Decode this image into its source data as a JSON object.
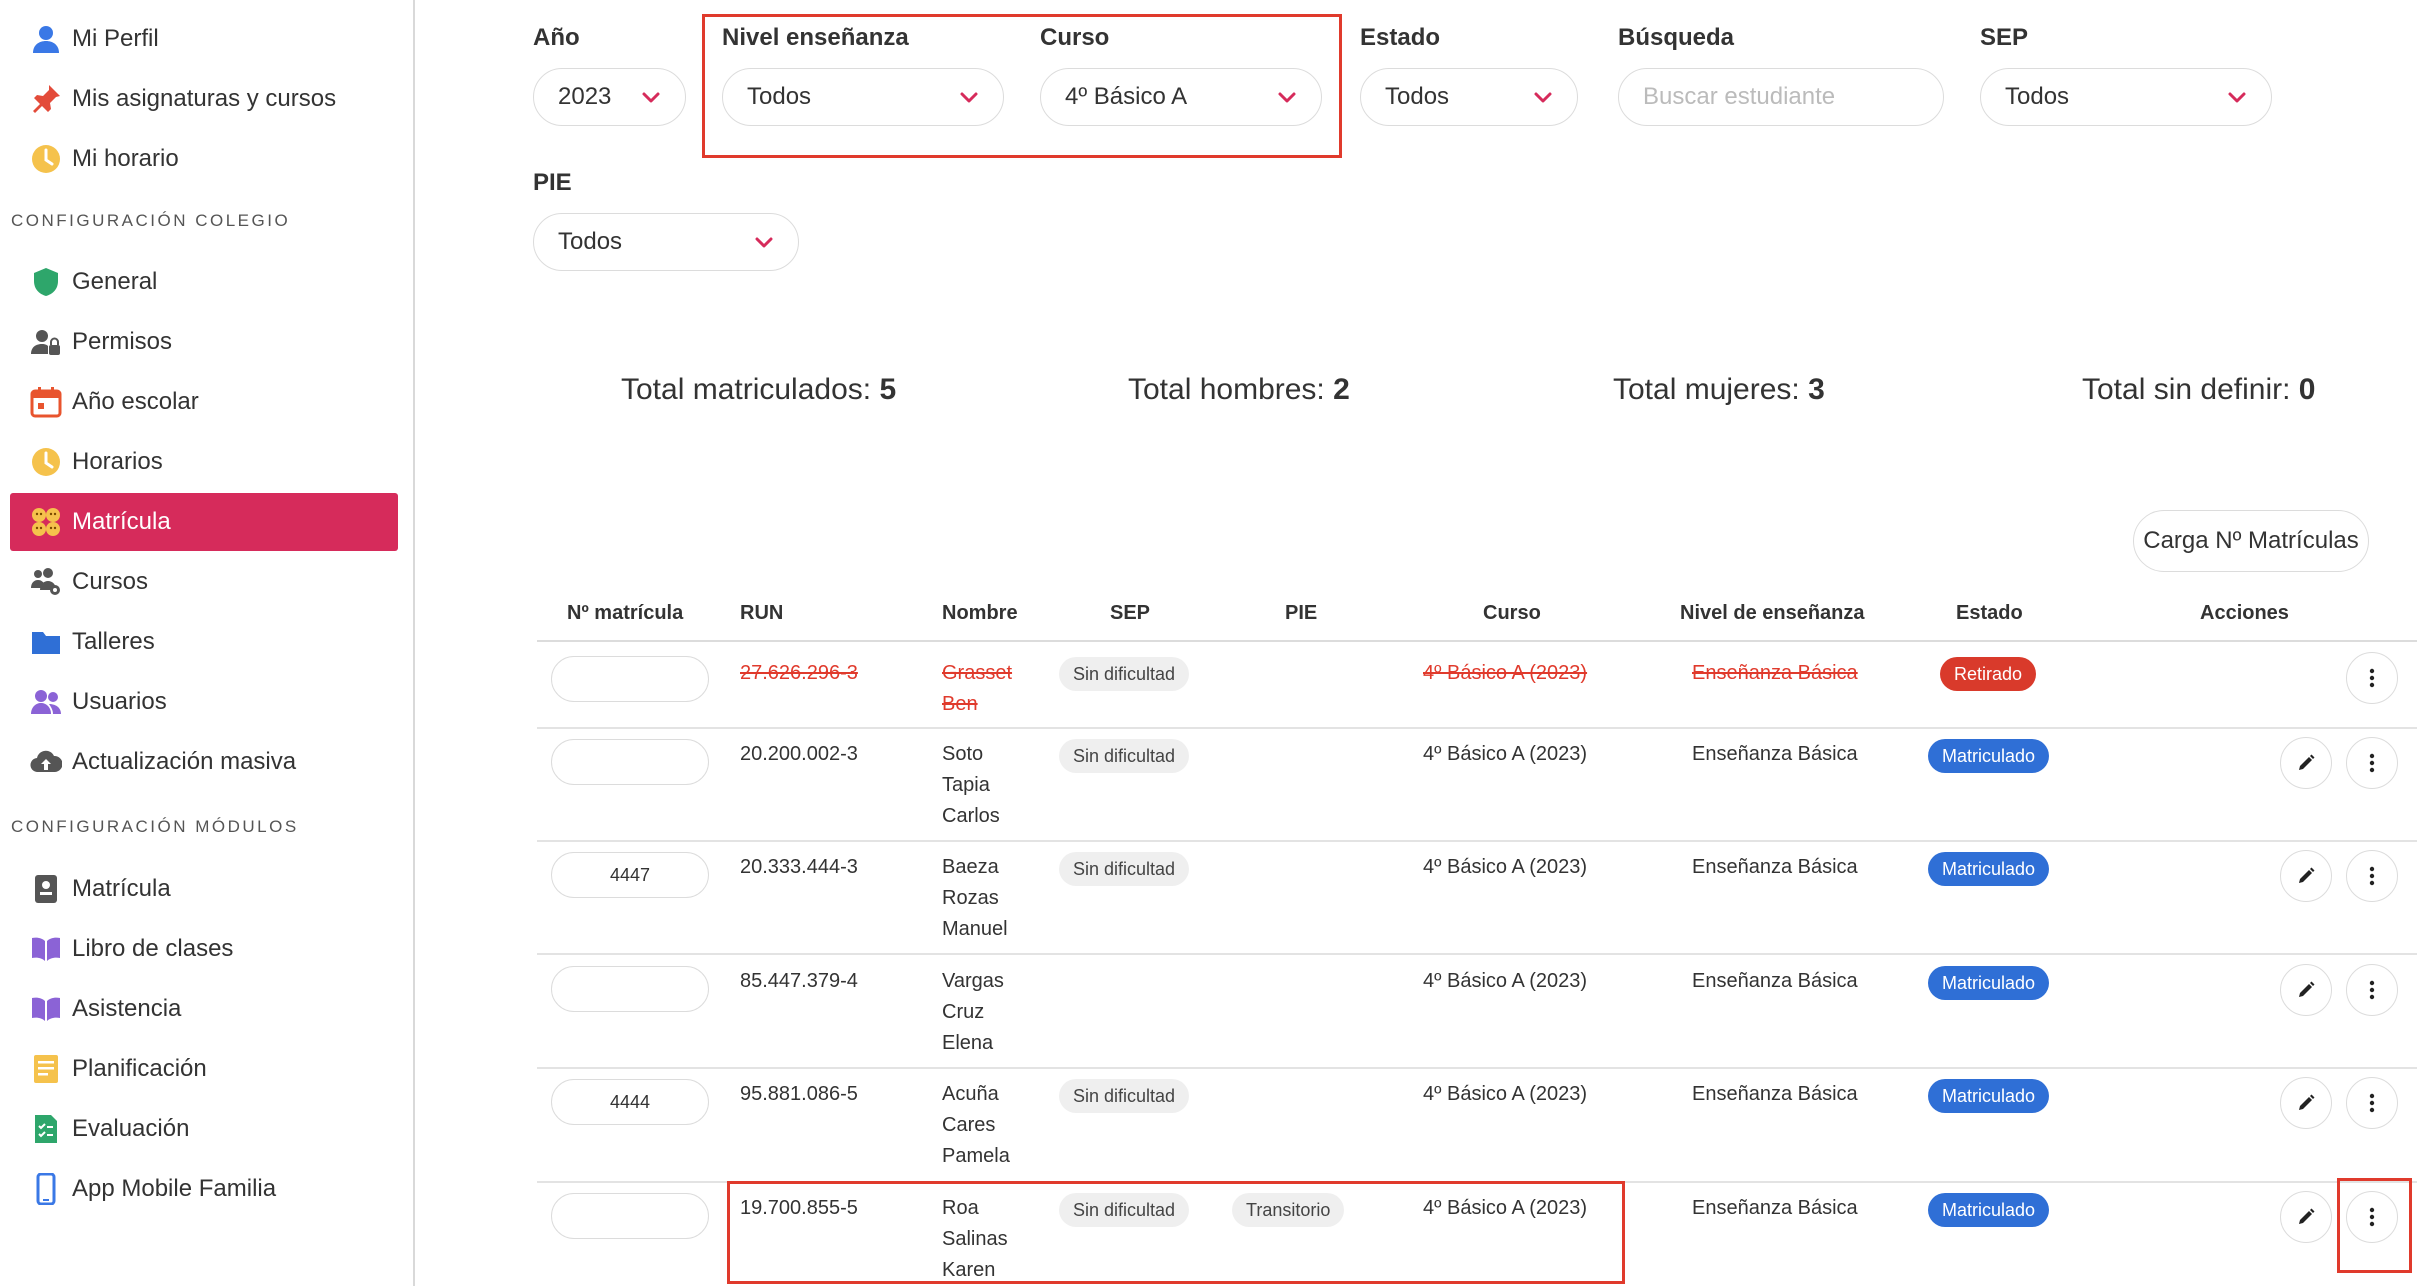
{
  "sidebar": {
    "items_top": [
      {
        "label": "Mi Perfil",
        "icon": "user-icon"
      },
      {
        "label": "Mis asignaturas y cursos",
        "icon": "pin-icon"
      },
      {
        "label": "Mi horario",
        "icon": "clock-icon"
      }
    ],
    "section_colegio": "CONFIGURACIÓN COLEGIO",
    "items_colegio": [
      {
        "label": "General",
        "icon": "shield-icon"
      },
      {
        "label": "Permisos",
        "icon": "user-lock-icon"
      },
      {
        "label": "Año escolar",
        "icon": "calendar-icon"
      },
      {
        "label": "Horarios",
        "icon": "clock-icon"
      },
      {
        "label": "Matrícula",
        "icon": "faces-icon"
      },
      {
        "label": "Cursos",
        "icon": "users-gear-icon"
      },
      {
        "label": "Talleres",
        "icon": "folder-icon"
      },
      {
        "label": "Usuarios",
        "icon": "users-icon"
      },
      {
        "label": "Actualización masiva",
        "icon": "cloud-upload-icon"
      }
    ],
    "section_modulos": "CONFIGURACIÓN MÓDULOS",
    "items_modulos": [
      {
        "label": "Matrícula",
        "icon": "id-card-icon"
      },
      {
        "label": "Libro de clases",
        "icon": "book-icon"
      },
      {
        "label": "Asistencia",
        "icon": "book-icon"
      },
      {
        "label": "Planificación",
        "icon": "notes-icon"
      },
      {
        "label": "Evaluación",
        "icon": "checklist-icon"
      },
      {
        "label": "App Mobile Familia",
        "icon": "mobile-icon"
      }
    ],
    "active_color": "#d62b5b"
  },
  "filters": {
    "anio": {
      "label": "Año",
      "value": "2023"
    },
    "nivel": {
      "label": "Nivel enseñanza",
      "value": "Todos"
    },
    "curso": {
      "label": "Curso",
      "value": "4º Básico A"
    },
    "estado": {
      "label": "Estado",
      "value": "Todos"
    },
    "busqueda": {
      "label": "Búsqueda",
      "placeholder": "Buscar estudiante"
    },
    "sep": {
      "label": "SEP",
      "value": "Todos"
    },
    "pie": {
      "label": "PIE",
      "value": "Todos"
    }
  },
  "totals": {
    "matriculados": {
      "label": "Total matriculados:",
      "value": "5"
    },
    "hombres": {
      "label": "Total hombres:",
      "value": "2"
    },
    "mujeres": {
      "label": "Total mujeres:",
      "value": "3"
    },
    "sin_definir": {
      "label": "Total sin definir:",
      "value": "0"
    }
  },
  "load_button": "Carga Nº Matrículas",
  "table": {
    "headers": {
      "matricula": "Nº matrícula",
      "run": "RUN",
      "nombre": "Nombre",
      "sep": "SEP",
      "pie": "PIE",
      "curso": "Curso",
      "nivel": "Nivel de enseñanza",
      "estado": "Estado",
      "acciones": "Acciones"
    },
    "rows": [
      {
        "matricula": "",
        "run": "27.626.296-3",
        "nombre": [
          "Grasset",
          "Ben"
        ],
        "sep": "Sin dificultad",
        "pie": "",
        "curso": "4º Básico A (2023)",
        "nivel": "Enseñanza Básica",
        "estado": "Retirado"
      },
      {
        "matricula": "",
        "run": "20.200.002-3",
        "nombre": [
          "Soto",
          "Tapia",
          "Carlos"
        ],
        "sep": "Sin dificultad",
        "pie": "",
        "curso": "4º Básico A (2023)",
        "nivel": "Enseñanza Básica",
        "estado": "Matriculado"
      },
      {
        "matricula": "4447",
        "run": "20.333.444-3",
        "nombre": [
          "Baeza",
          "Rozas",
          "Manuel"
        ],
        "sep": "Sin dificultad",
        "pie": "",
        "curso": "4º Básico A (2023)",
        "nivel": "Enseñanza Básica",
        "estado": "Matriculado"
      },
      {
        "matricula": "",
        "run": "85.447.379-4",
        "nombre": [
          "Vargas",
          "Cruz",
          "Elena"
        ],
        "sep": "",
        "pie": "",
        "curso": "4º Básico A (2023)",
        "nivel": "Enseñanza Básica",
        "estado": "Matriculado"
      },
      {
        "matricula": "4444",
        "run": "95.881.086-5",
        "nombre": [
          "Acuña",
          "Cares",
          "Pamela"
        ],
        "sep": "Sin dificultad",
        "pie": "",
        "curso": "4º Básico A (2023)",
        "nivel": "Enseñanza Básica",
        "estado": "Matriculado"
      },
      {
        "matricula": "",
        "run": "19.700.855-5",
        "nombre": [
          "Roa",
          "Salinas",
          "Karen"
        ],
        "sep": "Sin dificultad",
        "pie": "Transitorio",
        "curso": "4º Básico A (2023)",
        "nivel": "Enseñanza Básica",
        "estado": "Matriculado"
      }
    ]
  },
  "colors": {
    "accent_chevron": "#d62b5b",
    "badge_matriculado": "#2f6fd6",
    "badge_retirado": "#d93a2b",
    "highlight_box": "#e03a2c"
  }
}
